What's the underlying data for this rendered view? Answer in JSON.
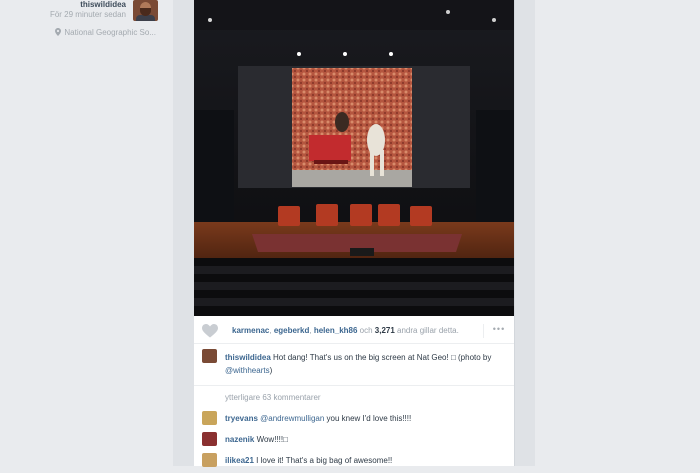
{
  "post": {
    "username": "thiswildidea",
    "time": "För 29 minuter sedan",
    "location": "National Geographic So..."
  },
  "likes": {
    "users": [
      "karmenac",
      "egeberkd",
      "helen_kh86"
    ],
    "sep1": ", ",
    "sep2": ", ",
    "och": " och ",
    "count": "3,271",
    "suffix": " andra gillar detta.",
    "more_label": "•••"
  },
  "caption": {
    "username": "thiswildidea",
    "text_before": " Hot dang! That's us on the big screen at Nat Geo! □ (photo by ",
    "mention": "@withhearts",
    "text_after": ")"
  },
  "more_comments_label": "ytterligare 63 kommentarer",
  "comments": [
    {
      "username": "tryevans",
      "mention": "@andrewmulligan",
      "text": " you knew I'd love this!!!!",
      "avatar_color": "#c9a55a"
    },
    {
      "username": "nazenik",
      "mention": "",
      "text": " Wow!!!!□",
      "avatar_color": "#8a3030"
    },
    {
      "username": "ilikea21",
      "mention": "",
      "text": " I love it! That's a big bag of awesome!!",
      "avatar_color": "#c8a060"
    }
  ],
  "colors": {
    "link": "#3d6790",
    "page_bg": "#e9ebee"
  }
}
